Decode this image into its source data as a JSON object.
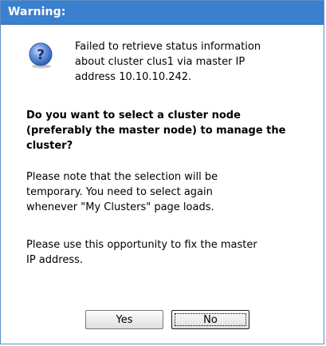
{
  "dialog": {
    "title": "Warning:",
    "icon": "question-icon",
    "message_line1": "Failed to retrieve status information",
    "message_line2": "about cluster clus1 via master IP",
    "message_line3": "address 10.10.10.242.",
    "question_line1": "Do you want to select a cluster node",
    "question_line2": "(preferably the master node) to manage the",
    "question_line3": "cluster?",
    "note_line1": "Please note that the selection will be",
    "note_line2": "temporary. You need to select again",
    "note_line3": "whenever \"My Clusters\" page loads.",
    "note2_line1": "Please use this opportunity to fix the master",
    "note2_line2": "IP address.",
    "yes_label": "Yes",
    "no_label": "No",
    "colors": {
      "title_bar": "#3b7fcf",
      "title_text": "#ffffff",
      "icon_fill": "#3f74c6"
    }
  }
}
